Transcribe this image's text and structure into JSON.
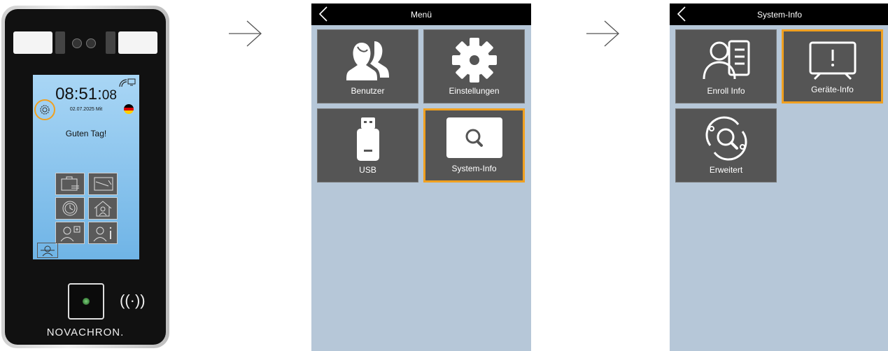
{
  "device": {
    "time_hm": "08:51:",
    "time_s": "08",
    "date": "02.07.2025  Mit",
    "greeting": "Guten Tag!",
    "brand": "NOVACHRON.",
    "nfc": "((·))"
  },
  "panel_menu": {
    "title": "Menü",
    "tiles": [
      {
        "label": "Benutzer",
        "icon": "users-icon"
      },
      {
        "label": "Einstellungen",
        "icon": "gear-icon"
      },
      {
        "label": "USB",
        "icon": "usb-icon"
      },
      {
        "label": "System-Info",
        "icon": "search-icon",
        "highlighted": true
      }
    ]
  },
  "panel_sysinfo": {
    "title": "System-Info",
    "tiles": [
      {
        "label": "Enroll Info",
        "icon": "user-card-icon"
      },
      {
        "label": "Geräte-Info",
        "icon": "monitor-alert-icon",
        "highlighted": true
      },
      {
        "label": "Erweitert",
        "icon": "orbit-search-icon"
      }
    ]
  },
  "colors": {
    "highlight": "#f0a020",
    "tile": "#555555",
    "panel_bg": "#b6c7d8"
  }
}
